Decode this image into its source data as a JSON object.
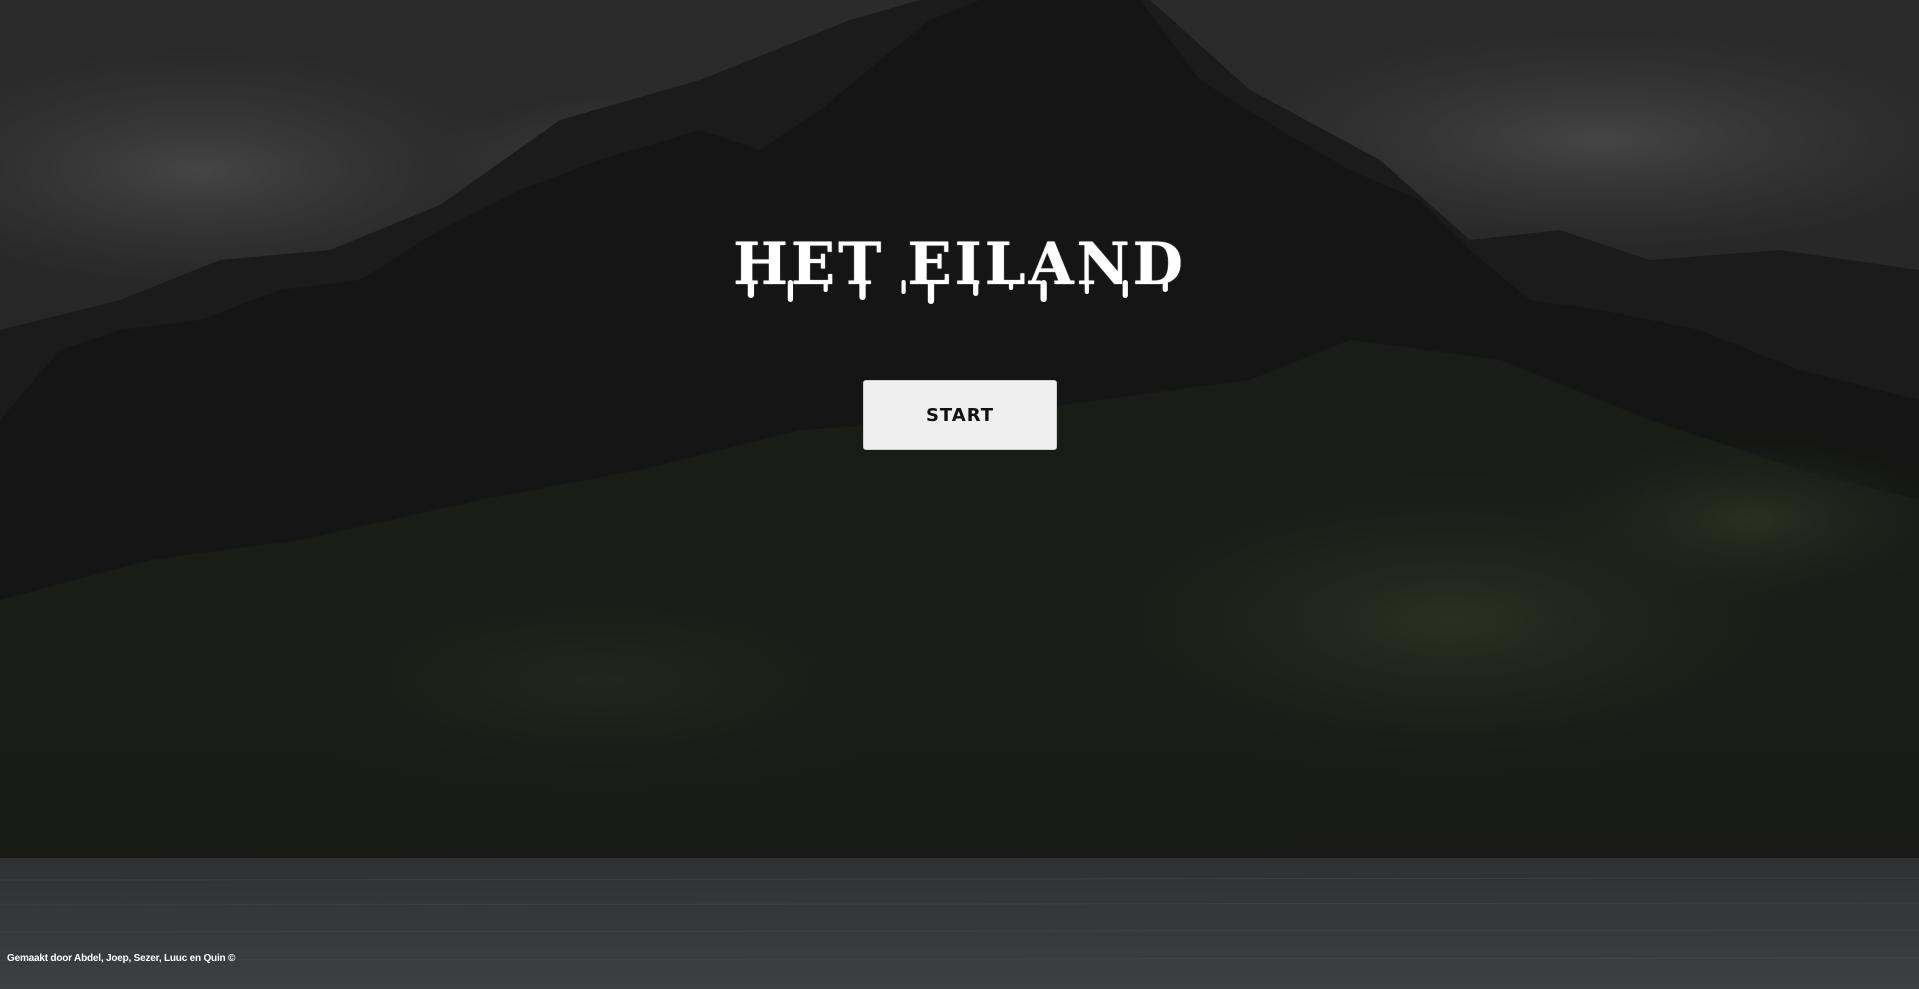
{
  "game": {
    "title": "HET EILAND",
    "start_label": "START",
    "footer_credit": "Gemaakt door Abdel, Joep, Sezer, Luuc en Quin ©"
  },
  "background": {
    "description_icon": "mountain-island-background",
    "sky_color": "#2a2a2a",
    "mountain_color": "#161a15",
    "sea_color": "#3a3c3d"
  }
}
